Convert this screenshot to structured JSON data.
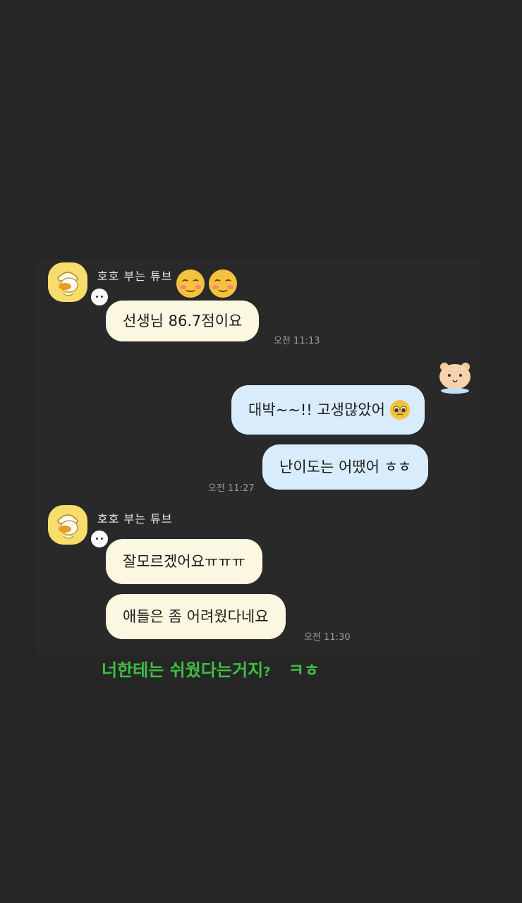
{
  "chat": {
    "group1": {
      "sender": "호호 부는 튜브",
      "messages": [
        "선생님 86.7점이요"
      ],
      "time": "오전 11:13"
    },
    "group2": {
      "messages": [
        "대박~~!! 고생많았어",
        "난이도는 어땠어 ㅎㅎ"
      ],
      "time": "오전 11:27"
    },
    "group3": {
      "sender": "호호 부는 튜브",
      "messages": [
        "잘모르겠어요ㅠㅠㅠ",
        "애들은 좀 어려웠다네요"
      ],
      "time": "오전 11:30"
    }
  },
  "caption": {
    "text": "너한테는  쉬웠다는거지",
    "question": "?",
    "suffix": "ㅋㅎ"
  },
  "colors": {
    "background": "#262626",
    "incoming_bubble": "#fbf7e1",
    "outgoing_bubble": "#d9ecfb",
    "caption": "#3fbf42",
    "avatar": "#f7dd6b"
  },
  "icons": [
    "tube-duck-avatar",
    "bear-avatar",
    "smiling-blush-emoji",
    "pleading-face-emoji"
  ]
}
